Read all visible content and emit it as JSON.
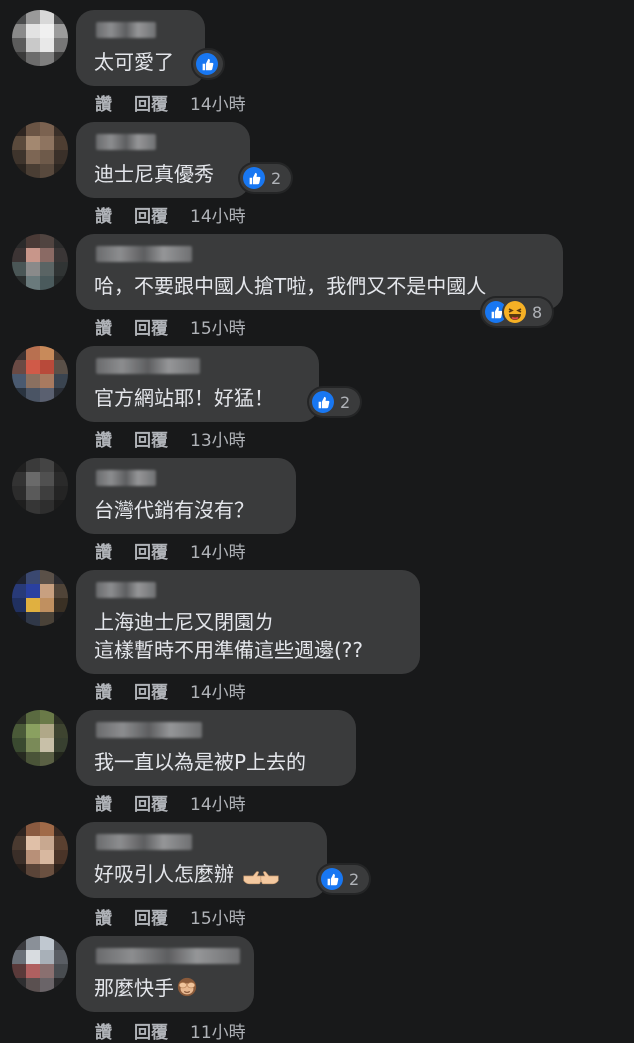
{
  "actions": {
    "like": "讚",
    "reply": "回覆"
  },
  "colors": {
    "background": "#18191a",
    "bubble": "#3a3b3c",
    "like_blue": "#1877f2",
    "haha_yellow": "#f7b125",
    "secondary_text": "#b0b3b8"
  },
  "comments": [
    {
      "lines": [
        "太可愛了"
      ],
      "time": "14小時",
      "reactions": [
        "like"
      ],
      "count": ""
    },
    {
      "lines": [
        "迪士尼真優秀"
      ],
      "time": "14小時",
      "reactions": [
        "like"
      ],
      "count": "2"
    },
    {
      "lines": [
        "哈，不要跟中國人搶T啦，我們又不是中國人"
      ],
      "time": "15小時",
      "reactions": [
        "like",
        "haha"
      ],
      "count": "8"
    },
    {
      "lines": [
        "官方網站耶！好猛！"
      ],
      "time": "13小時",
      "reactions": [
        "like"
      ],
      "count": "2"
    },
    {
      "lines": [
        "台灣代銷有沒有？"
      ],
      "time": "14小時",
      "reactions": [],
      "count": ""
    },
    {
      "lines": [
        "上海迪士尼又閉園ㄌ",
        "這樣暫時不用準備這些週邊(??"
      ],
      "time": "14小時",
      "reactions": [],
      "count": ""
    },
    {
      "lines": [
        "我一直以為是被P上去的"
      ],
      "time": "14小時",
      "reactions": [],
      "count": ""
    },
    {
      "lines": [
        "好吸引人怎麼辦"
      ],
      "time": "15小時",
      "reactions": [
        "like"
      ],
      "count": "2",
      "emoji": "pointing-hands"
    },
    {
      "lines": [
        "那麼快手"
      ],
      "time": "11小時",
      "reactions": [],
      "count": "",
      "emoji": "see-no-evil-monkey"
    }
  ]
}
